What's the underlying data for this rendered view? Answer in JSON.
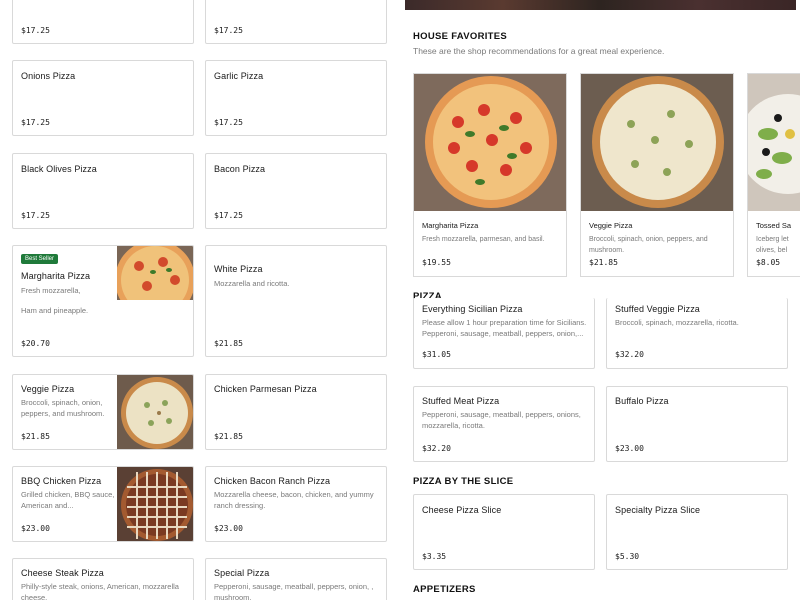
{
  "left_menu": {
    "row0": [
      {
        "price": "$17.25"
      },
      {
        "price": "$17.25"
      }
    ],
    "row1": [
      {
        "name": "Onions Pizza",
        "price": "$17.25"
      },
      {
        "name": "Garlic Pizza",
        "price": "$17.25"
      }
    ],
    "row2": [
      {
        "name": "Black Olives Pizza",
        "price": "$17.25"
      },
      {
        "name": "Bacon Pizza",
        "price": "$17.25"
      }
    ],
    "row3": [
      {
        "badge": "Best Seller",
        "name": "Margharita Pizza",
        "desc": "Fresh mozzarella,",
        "desc2": "Ham and pineapple.",
        "price": "$20.70"
      },
      {
        "name": "White Pizza",
        "desc": "Mozzarella and ricotta.",
        "price": "$21.85"
      }
    ],
    "row4": [
      {
        "name": "Veggie Pizza",
        "desc": "Broccoli, spinach, onion, peppers, and mushroom.",
        "price": "$21.85"
      },
      {
        "name": "Chicken Parmesan Pizza",
        "price": "$21.85"
      }
    ],
    "row5": [
      {
        "name": "BBQ Chicken Pizza",
        "desc": "Grilled chicken, BBQ sauce, American and...",
        "price": "$23.00"
      },
      {
        "name": "Chicken Bacon Ranch Pizza",
        "desc": "Mozzarella cheese, bacon, chicken, and yummy ranch dressing.",
        "price": "$23.00"
      }
    ],
    "row6": [
      {
        "name": "Cheese Steak Pizza",
        "desc": "Philly-style steak, onions, American, mozzarella cheese."
      },
      {
        "name": "Special Pizza",
        "desc": "Pepperoni, sausage, meatball, peppers, onion, , mushroom."
      }
    ]
  },
  "house_favorites": {
    "title": "HOUSE FAVORITES",
    "subtitle": "These are the shop recommendations for a great meal experience.",
    "items": [
      {
        "name": "Margharita Pizza",
        "desc": "Fresh mozzarella, parmesan, and basil.",
        "price": "$19.55"
      },
      {
        "name": "Veggie Pizza",
        "desc": "Broccoli, spinach, onion, peppers, and mushroom.",
        "price": "$21.85"
      },
      {
        "name": "Tossed Sa",
        "desc": "Iceberg let olives, bel",
        "price": "$8.05"
      }
    ]
  },
  "pizza": {
    "title": "PIZZA",
    "items": [
      {
        "name": "Everything Sicilian Pizza",
        "desc": "Please allow 1 hour preparation time for Sicilians. Pepperoni, sausage, meatball, peppers, onion,...",
        "price": "$31.05"
      },
      {
        "name": "Stuffed Veggie Pizza",
        "desc": "Broccoli, spinach, mozzarella, ricotta.",
        "price": "$32.20"
      },
      {
        "name": "Stuffed Meat Pizza",
        "desc": "Pepperoni, sausage, meatball, peppers, onions, mozzarella, ricotta.",
        "price": "$32.20"
      },
      {
        "name": "Buffalo Pizza",
        "price": "$23.00"
      }
    ]
  },
  "slice": {
    "title": "PIZZA BY THE SLICE",
    "items": [
      {
        "name": "Cheese Pizza Slice",
        "price": "$3.35"
      },
      {
        "name": "Specialty Pizza Slice",
        "price": "$5.30"
      }
    ]
  },
  "appetizers": {
    "title": "APPETIZERS"
  },
  "colors": {
    "accent_green": "#1f7a3a",
    "border": "#d9d9d9",
    "muted_text": "#7a7a7a"
  }
}
